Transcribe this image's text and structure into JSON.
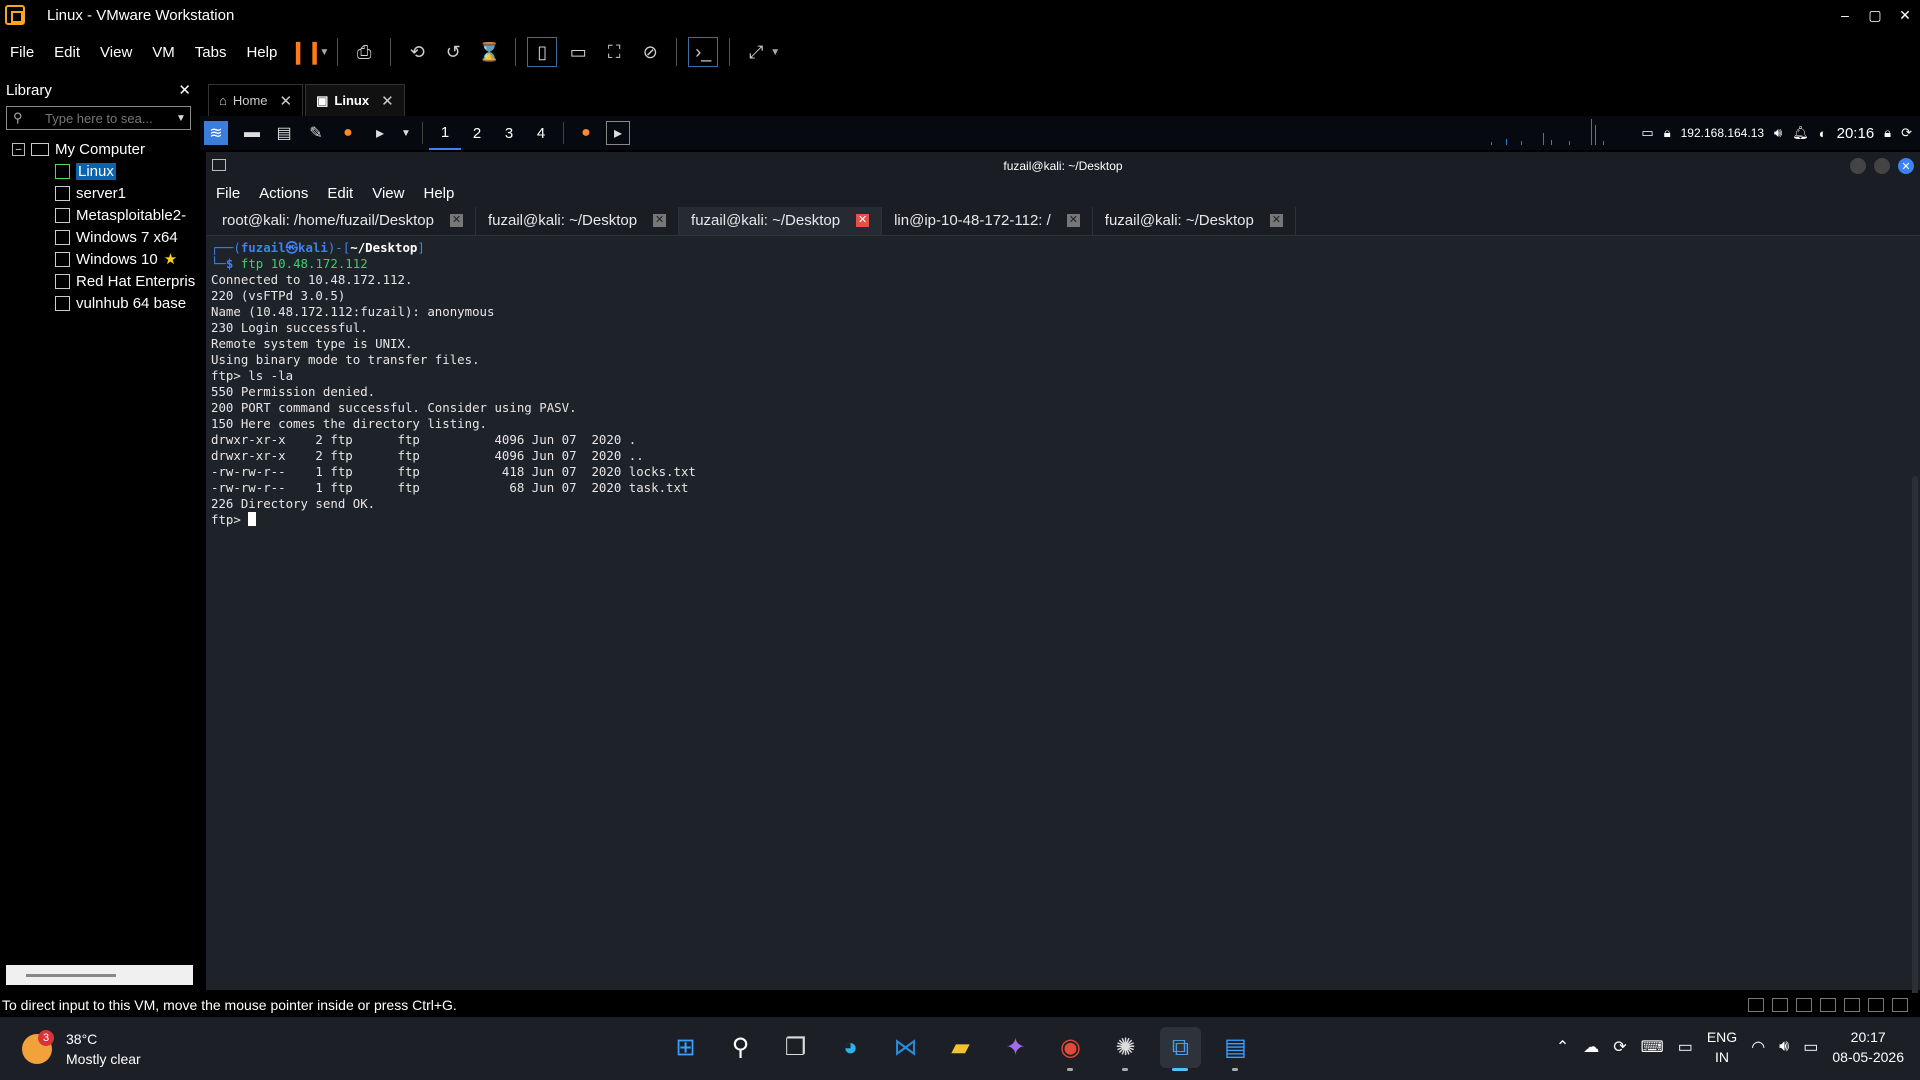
{
  "window": {
    "title": "Linux - VMware Workstation"
  },
  "menubar": {
    "items": [
      "File",
      "Edit",
      "View",
      "VM",
      "Tabs",
      "Help"
    ]
  },
  "library": {
    "title": "Library",
    "search_placeholder": "Type here to sea...",
    "root": "My Computer",
    "vms": [
      "Linux",
      "server1",
      "Metasploitable2-",
      "Windows 7 x64",
      "Windows 10",
      "Red Hat Enterpris",
      "vulnhub 64 base"
    ]
  },
  "vm_tabs": [
    {
      "label": "Home"
    },
    {
      "label": "Linux"
    }
  ],
  "kali_panel": {
    "workspaces": [
      "1",
      "2",
      "3",
      "4"
    ],
    "ip": "192.168.164.13",
    "time": "20:16"
  },
  "terminal": {
    "title": "fuzail@kali: ~/Desktop",
    "menu": [
      "File",
      "Actions",
      "Edit",
      "View",
      "Help"
    ],
    "tabs": [
      "root@kali: /home/fuzail/Desktop",
      "fuzail@kali: ~/Desktop",
      "fuzail@kali: ~/Desktop",
      "lin@ip-10-48-172-112: /",
      "fuzail@kali: ~/Desktop"
    ],
    "prompt_user": "fuzail㉿kali",
    "prompt_cwd": "~/Desktop",
    "command": "ftp 10.48.172.112",
    "output": "Connected to 10.48.172.112.\n220 (vsFTPd 3.0.5)\nName (10.48.172.112:fuzail): anonymous\n230 Login successful.\nRemote system type is UNIX.\nUsing binary mode to transfer files.\nftp> ls -la\n550 Permission denied.\n200 PORT command successful. Consider using PASV.\n150 Here comes the directory listing.\ndrwxr-xr-x    2 ftp      ftp          4096 Jun 07  2020 .\ndrwxr-xr-x    2 ftp      ftp          4096 Jun 07  2020 ..\n-rw-rw-r--    1 ftp      ftp           418 Jun 07  2020 locks.txt\n-rw-rw-r--    1 ftp      ftp            68 Jun 07  2020 task.txt\n226 Directory send OK.",
    "final_prompt": "ftp> "
  },
  "status_bar": {
    "text": "To direct input to this VM, move the mouse pointer inside or press Ctrl+G."
  },
  "weather": {
    "temp": "38°C",
    "desc": "Mostly clear",
    "badge": "3"
  },
  "tray": {
    "lang_top": "ENG",
    "lang_bottom": "IN",
    "time": "20:17",
    "date": "08-05-2026"
  }
}
